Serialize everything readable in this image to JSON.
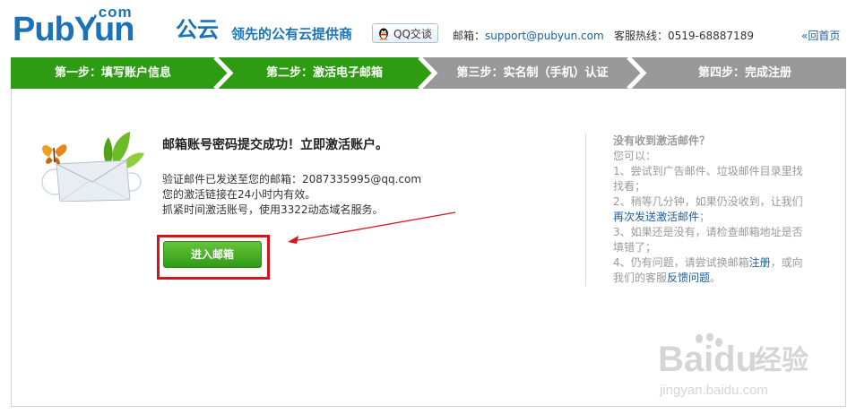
{
  "header": {
    "logo_com": ".com",
    "logo_main": "PubYun",
    "logo_cn": "公云",
    "slogan": "领先的公有云提供商",
    "qq_label": "QQ交谈",
    "email_label": "邮箱：",
    "email_value": "support@pubyun.com",
    "phone_label": "客服热线：",
    "phone_value": "0519-68887189",
    "back_label": "«回首页"
  },
  "steps": [
    {
      "label": "第一步：填写账户信息",
      "state": "done"
    },
    {
      "label": "第二步：激活电子邮箱",
      "state": "current"
    },
    {
      "label": "第三步：实名制（手机）认证",
      "state": "pending"
    },
    {
      "label": "第四步：完成注册",
      "state": "pending"
    }
  ],
  "colors": {
    "step_active": "#2e9c12",
    "step_inactive": "#999999",
    "brand_blue": "#1a73b8",
    "highlight_red": "#d4161c"
  },
  "main": {
    "title": "邮箱账号密码提交成功！立即激活账户。",
    "line1": "验证邮件已发送至您的邮箱：2087335995@qq.com",
    "line2": "您的激活链接在24小时内有效。",
    "line3": "抓紧时间激活账号，使用3322动态域名服务。",
    "button_label": "进入邮箱"
  },
  "help": {
    "title": "没有收到激活邮件？",
    "intro": "您可以：",
    "tip1": "1、尝试到广告邮件、垃圾邮件目录里找找看；",
    "tip2_a": "2、稍等几分钟，如果仍没收到，让我们",
    "tip2_link": "再次发送激活邮件",
    "tip2_b": "；",
    "tip3": "3、如果还是没有，请检查邮箱地址是否填错了；",
    "tip4_a": "4、仍有问题，请尝试换邮箱",
    "tip4_link1": "注册",
    "tip4_b": "，或向我们的客服",
    "tip4_link2": "反馈问题",
    "tip4_c": "。"
  },
  "watermark": {
    "brand": "Baidu",
    "brand_cn": "经验",
    "url": "jingyan.baidu.com"
  }
}
